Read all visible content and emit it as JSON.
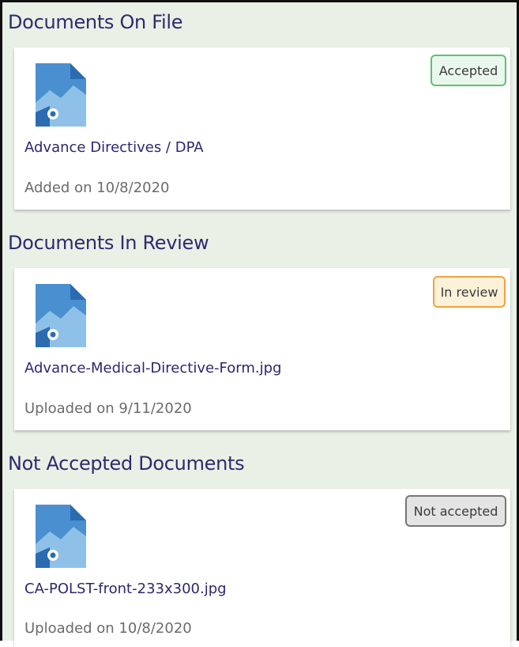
{
  "sections": [
    {
      "title": "Documents On File",
      "document": {
        "name": "Advance Directives / DPA",
        "date_text": "Added on 10/8/2020",
        "status": "Accepted",
        "status_color": "#5cc173"
      }
    },
    {
      "title": "Documents In Review",
      "document": {
        "name": "Advance-Medical-Directive-Form.jpg",
        "date_text": "Uploaded on 9/11/2020",
        "status": "In review",
        "status_color": "#f0a23e"
      }
    },
    {
      "title": "Not Accepted Documents",
      "document": {
        "name": "CA-POLST-front-233x300.jpg",
        "date_text": "Uploaded on 10/8/2020",
        "status": "Not accepted",
        "status_color": "#777777"
      }
    }
  ],
  "icons": {
    "document": "image-file-icon"
  },
  "colors": {
    "background": "#e9f0e6",
    "heading": "#2e2a6e",
    "link": "#2d2672",
    "icon": "#4a90d0"
  }
}
